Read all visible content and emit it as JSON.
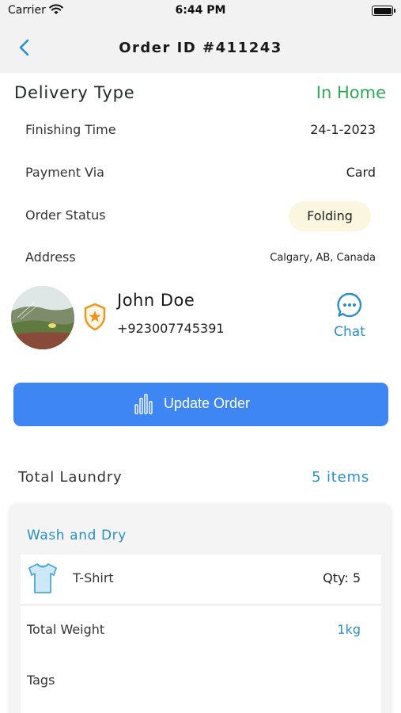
{
  "status_bar": {
    "carrier": "Carrier",
    "time": "6:44 PM"
  },
  "nav": {
    "title": "Order ID #411243",
    "back_icon": "chevron-left-icon"
  },
  "delivery": {
    "label": "Delivery Type",
    "value": "In Home",
    "value_color": "#2eaa55"
  },
  "details": {
    "finishing_label": "Finishing Time",
    "finishing_value": "24-1-2023",
    "payment_label": "Payment Via",
    "payment_value": "Card",
    "status_label": "Order Status",
    "status_value": "Folding",
    "address_label": "Address",
    "address_value": "Calgary, AB, Canada"
  },
  "customer": {
    "name": "John Doe",
    "phone": "+923007745391",
    "chat_label": "Chat",
    "badge_icon": "shield-star-icon",
    "chat_icon": "chat-bubble-icon"
  },
  "update_button": {
    "label": "Update Order",
    "icon": "bar-chart-icon",
    "color": "#3f86f5"
  },
  "laundry": {
    "label": "Total Laundry",
    "count": "5 items"
  },
  "service": {
    "title": "Wash and Dry",
    "items": [
      {
        "name": "T-Shirt",
        "qty": "Qty: 5",
        "icon": "tshirt-icon"
      }
    ],
    "weight_label": "Total Weight",
    "weight_value": "1kg",
    "tags_label": "Tags"
  },
  "accent_color": "#2a8fc9"
}
